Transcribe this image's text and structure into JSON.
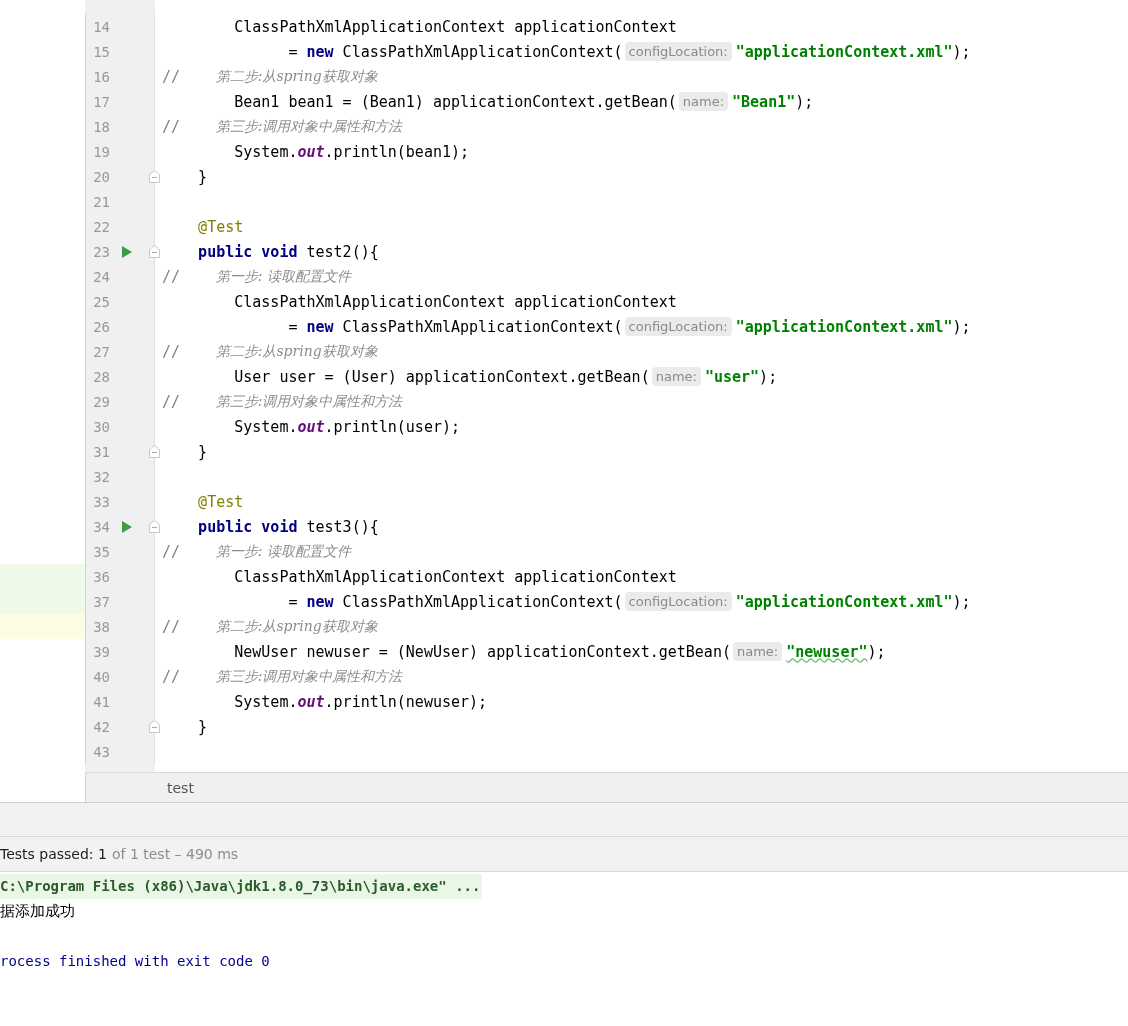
{
  "editor": {
    "lines": [
      {
        "number": "14",
        "run": false,
        "fold": false,
        "added": false,
        "current": false,
        "tokens": [
          {
            "kind": "plain",
            "text": "        ClassPathXmlApplicationContext applicationContext"
          }
        ]
      },
      {
        "number": "15",
        "run": false,
        "fold": false,
        "added": false,
        "current": false,
        "tokens": [
          {
            "kind": "plain",
            "text": "              = "
          },
          {
            "kind": "keyword",
            "text": "new"
          },
          {
            "kind": "plain",
            "text": " ClassPathXmlApplicationContext("
          },
          {
            "kind": "hint",
            "text": "configLocation:"
          },
          {
            "kind": "string",
            "text": "\"applicationContext.xml\""
          },
          {
            "kind": "plain",
            "text": ");"
          }
        ]
      },
      {
        "number": "16",
        "run": false,
        "fold": false,
        "added": false,
        "current": false,
        "tokens": [
          {
            "kind": "comment-mark",
            "text": "//"
          },
          {
            "kind": "comment",
            "text": "        第二步:从spring获取对象"
          }
        ]
      },
      {
        "number": "17",
        "run": false,
        "fold": false,
        "added": false,
        "current": false,
        "tokens": [
          {
            "kind": "plain",
            "text": "        Bean1 bean1 = (Bean1) applicationContext.getBean("
          },
          {
            "kind": "hint",
            "text": "name:"
          },
          {
            "kind": "string",
            "text": "\"Bean1\""
          },
          {
            "kind": "plain",
            "text": ");"
          }
        ]
      },
      {
        "number": "18",
        "run": false,
        "fold": false,
        "added": false,
        "current": false,
        "tokens": [
          {
            "kind": "comment-mark",
            "text": "//"
          },
          {
            "kind": "comment",
            "text": "        第三步:调用对象中属性和方法"
          }
        ]
      },
      {
        "number": "19",
        "run": false,
        "fold": false,
        "added": false,
        "current": false,
        "tokens": [
          {
            "kind": "plain",
            "text": "        System."
          },
          {
            "kind": "field",
            "text": "out"
          },
          {
            "kind": "plain",
            "text": ".println(bean1);"
          }
        ]
      },
      {
        "number": "20",
        "run": false,
        "fold": true,
        "added": false,
        "current": false,
        "tokens": [
          {
            "kind": "plain",
            "text": "    }"
          }
        ]
      },
      {
        "number": "21",
        "run": false,
        "fold": false,
        "added": false,
        "current": false
      },
      {
        "number": "22",
        "run": false,
        "fold": false,
        "added": false,
        "current": false,
        "tokens": [
          {
            "kind": "annotation",
            "text": "    @Test"
          }
        ]
      },
      {
        "number": "23",
        "run": true,
        "fold": true,
        "added": false,
        "current": false,
        "tokens": [
          {
            "kind": "keyword",
            "text": "    public void"
          },
          {
            "kind": "plain",
            "text": " test2(){"
          }
        ]
      },
      {
        "number": "24",
        "run": false,
        "fold": false,
        "added": false,
        "current": false,
        "tokens": [
          {
            "kind": "comment-mark",
            "text": "//"
          },
          {
            "kind": "comment",
            "text": "        第一步: 读取配置文件"
          }
        ]
      },
      {
        "number": "25",
        "run": false,
        "fold": false,
        "added": false,
        "current": false,
        "tokens": [
          {
            "kind": "plain",
            "text": "        ClassPathXmlApplicationContext applicationContext"
          }
        ]
      },
      {
        "number": "26",
        "run": false,
        "fold": false,
        "added": false,
        "current": false,
        "tokens": [
          {
            "kind": "plain",
            "text": "              = "
          },
          {
            "kind": "keyword",
            "text": "new"
          },
          {
            "kind": "plain",
            "text": " ClassPathXmlApplicationContext("
          },
          {
            "kind": "hint",
            "text": "configLocation:"
          },
          {
            "kind": "string",
            "text": "\"applicationContext.xml\""
          },
          {
            "kind": "plain",
            "text": ");"
          }
        ]
      },
      {
        "number": "27",
        "run": false,
        "fold": false,
        "added": false,
        "current": false,
        "tokens": [
          {
            "kind": "comment-mark",
            "text": "//"
          },
          {
            "kind": "comment",
            "text": "        第二步:从spring获取对象"
          }
        ]
      },
      {
        "number": "28",
        "run": false,
        "fold": false,
        "added": false,
        "current": false,
        "tokens": [
          {
            "kind": "plain",
            "text": "        User user = (User) applicationContext.getBean("
          },
          {
            "kind": "hint",
            "text": "name:"
          },
          {
            "kind": "string",
            "text": "\"user\""
          },
          {
            "kind": "plain",
            "text": ");"
          }
        ]
      },
      {
        "number": "29",
        "run": false,
        "fold": false,
        "added": false,
        "current": false,
        "tokens": [
          {
            "kind": "comment-mark",
            "text": "//"
          },
          {
            "kind": "comment",
            "text": "        第三步:调用对象中属性和方法"
          }
        ]
      },
      {
        "number": "30",
        "run": false,
        "fold": false,
        "added": false,
        "current": false,
        "tokens": [
          {
            "kind": "plain",
            "text": "        System."
          },
          {
            "kind": "field",
            "text": "out"
          },
          {
            "kind": "plain",
            "text": ".println(user);"
          }
        ]
      },
      {
        "number": "31",
        "run": false,
        "fold": true,
        "added": false,
        "current": false,
        "tokens": [
          {
            "kind": "plain",
            "text": "    }"
          }
        ]
      },
      {
        "number": "32",
        "run": false,
        "fold": false,
        "added": false,
        "current": false
      },
      {
        "number": "33",
        "run": false,
        "fold": false,
        "added": false,
        "current": false,
        "tokens": [
          {
            "kind": "annotation",
            "text": "    @Test"
          }
        ]
      },
      {
        "number": "34",
        "run": true,
        "fold": true,
        "added": false,
        "current": false,
        "tokens": [
          {
            "kind": "keyword",
            "text": "    public void"
          },
          {
            "kind": "plain",
            "text": " test3(){"
          }
        ]
      },
      {
        "number": "35",
        "run": false,
        "fold": false,
        "added": false,
        "current": false,
        "tokens": [
          {
            "kind": "comment-mark",
            "text": "//"
          },
          {
            "kind": "comment",
            "text": "        第一步: 读取配置文件"
          }
        ]
      },
      {
        "number": "36",
        "run": false,
        "fold": false,
        "added": true,
        "current": false,
        "tokens": [
          {
            "kind": "plain",
            "text": "        ClassPathXmlApplicationContext applicationContext"
          }
        ]
      },
      {
        "number": "37",
        "run": false,
        "fold": false,
        "added": true,
        "current": false,
        "tokens": [
          {
            "kind": "plain",
            "text": "              = "
          },
          {
            "kind": "keyword",
            "text": "new"
          },
          {
            "kind": "plain",
            "text": " ClassPathXmlApplicationContext("
          },
          {
            "kind": "hint",
            "text": "configLocation:"
          },
          {
            "kind": "string",
            "text": "\"applicationContext.xml\""
          },
          {
            "kind": "plain",
            "text": ");"
          }
        ]
      },
      {
        "number": "38",
        "run": false,
        "fold": false,
        "added": false,
        "current": true,
        "tokens": [
          {
            "kind": "comment-mark",
            "text": "//"
          },
          {
            "kind": "comment",
            "text": "        第二步:从spring获取对象"
          }
        ]
      },
      {
        "number": "39",
        "run": false,
        "fold": false,
        "added": false,
        "current": false,
        "tokens": [
          {
            "kind": "plain",
            "text": "        NewUser newuser = (NewUser) applicationContext.getBean("
          },
          {
            "kind": "hint",
            "text": "name:"
          },
          {
            "kind": "typo-string",
            "text": "\"newuser\""
          },
          {
            "kind": "plain",
            "text": ");"
          }
        ]
      },
      {
        "number": "40",
        "run": false,
        "fold": false,
        "added": false,
        "current": false,
        "tokens": [
          {
            "kind": "comment-mark",
            "text": "//"
          },
          {
            "kind": "comment",
            "text": "        第三步:调用对象中属性和方法"
          }
        ]
      },
      {
        "number": "41",
        "run": false,
        "fold": false,
        "added": false,
        "current": false,
        "tokens": [
          {
            "kind": "plain",
            "text": "        System."
          },
          {
            "kind": "field",
            "text": "out"
          },
          {
            "kind": "plain",
            "text": ".println(newuser);"
          }
        ]
      },
      {
        "number": "42",
        "run": false,
        "fold": true,
        "added": false,
        "current": false,
        "tokens": [
          {
            "kind": "plain",
            "text": "    }"
          }
        ]
      },
      {
        "number": "43",
        "run": false,
        "fold": false,
        "added": false,
        "current": false
      }
    ]
  },
  "breadcrumb": "test",
  "test_status": {
    "passed": "Tests passed: 1",
    "detail": "of 1 test – 490 ms"
  },
  "console": [
    {
      "kind": "command",
      "text": "C:\\Program Files (x86)\\Java\\jdk1.8.0_73\\bin\\java.exe\" ..."
    },
    {
      "kind": "output",
      "text": "据添加成功"
    },
    {
      "kind": "blank"
    },
    {
      "kind": "exit",
      "text": "rocess finished with exit code 0"
    }
  ]
}
